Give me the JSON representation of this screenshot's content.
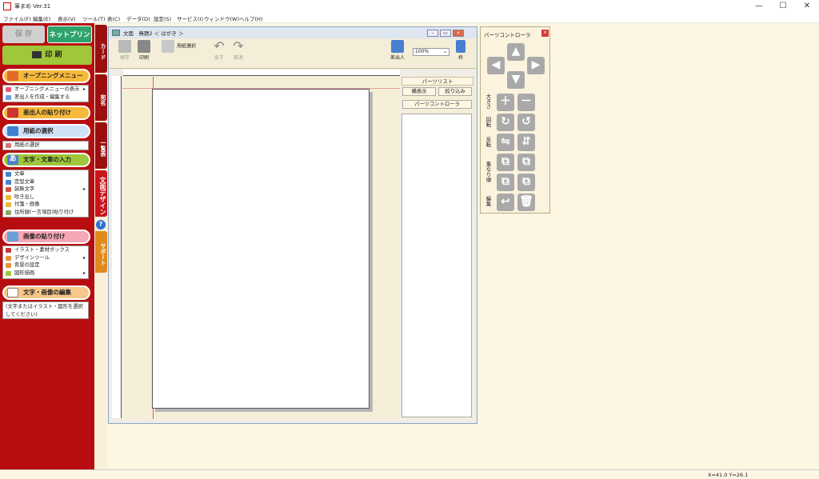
{
  "window": {
    "title": "筆まめ Ver.31",
    "minimize": "—",
    "maximize": "☐",
    "close": "✕"
  },
  "menu": [
    "ファイル(F)",
    "編集(E)",
    "表示(V)",
    "ツール(T)",
    "表(C)",
    "データ(D)",
    "設定(S)",
    "サービス(I)",
    "ウィンドウ(W)",
    "ヘルプ(H)"
  ],
  "left": {
    "save": "保 存",
    "netprint": "ネットプリント",
    "print": "印 刷",
    "sections": {
      "opening": {
        "title": "オープニングメニュー",
        "items": [
          "オープニングメニューの表示",
          "差出人を作成・編集する"
        ]
      },
      "sender": {
        "title": "差出人の貼り付け"
      },
      "paper": {
        "title": "用紙の選択",
        "items": [
          "用紙の選択"
        ]
      },
      "text": {
        "title": "文字・文章の入力",
        "items": [
          "文章",
          "定型文章",
          "装飾文字",
          "吹き出し",
          "付箋・画像",
          "住所録(一言項目)貼り付け"
        ]
      },
      "image": {
        "title": "画像の貼り付け",
        "items": [
          "イラスト・素材ボックス",
          "デザインツール",
          "背景の設定",
          "図形描画"
        ]
      },
      "edit": {
        "title": "文字・画像の編集",
        "hint": "(文字またはイラスト・図形を選択してください)"
      }
    }
  },
  "vtabs": [
    "カード",
    "宛名",
    "一覧表",
    "文面デザイン",
    "サポート"
  ],
  "doc": {
    "title": "文面　無題2 ＜ はがき ＞",
    "toolbar": {
      "save": "保存",
      "print": "印刷",
      "paper": "用紙選択",
      "undo": "戻す",
      "redo": "取消",
      "sender": "差出人",
      "zoom": "100%",
      "frame": "枠"
    },
    "partslist": {
      "title": "パーツリスト",
      "show_all": "横表示",
      "filter": "絞り込み",
      "controller": "パーツコントローラ"
    }
  },
  "palette": {
    "title": "パーツコントローラ",
    "close": "x",
    "labels": [
      "大きさ",
      "回転",
      "反転",
      "重なり順",
      "編集"
    ]
  },
  "status": {
    "coord": "X=41.0 Y=26.1"
  }
}
